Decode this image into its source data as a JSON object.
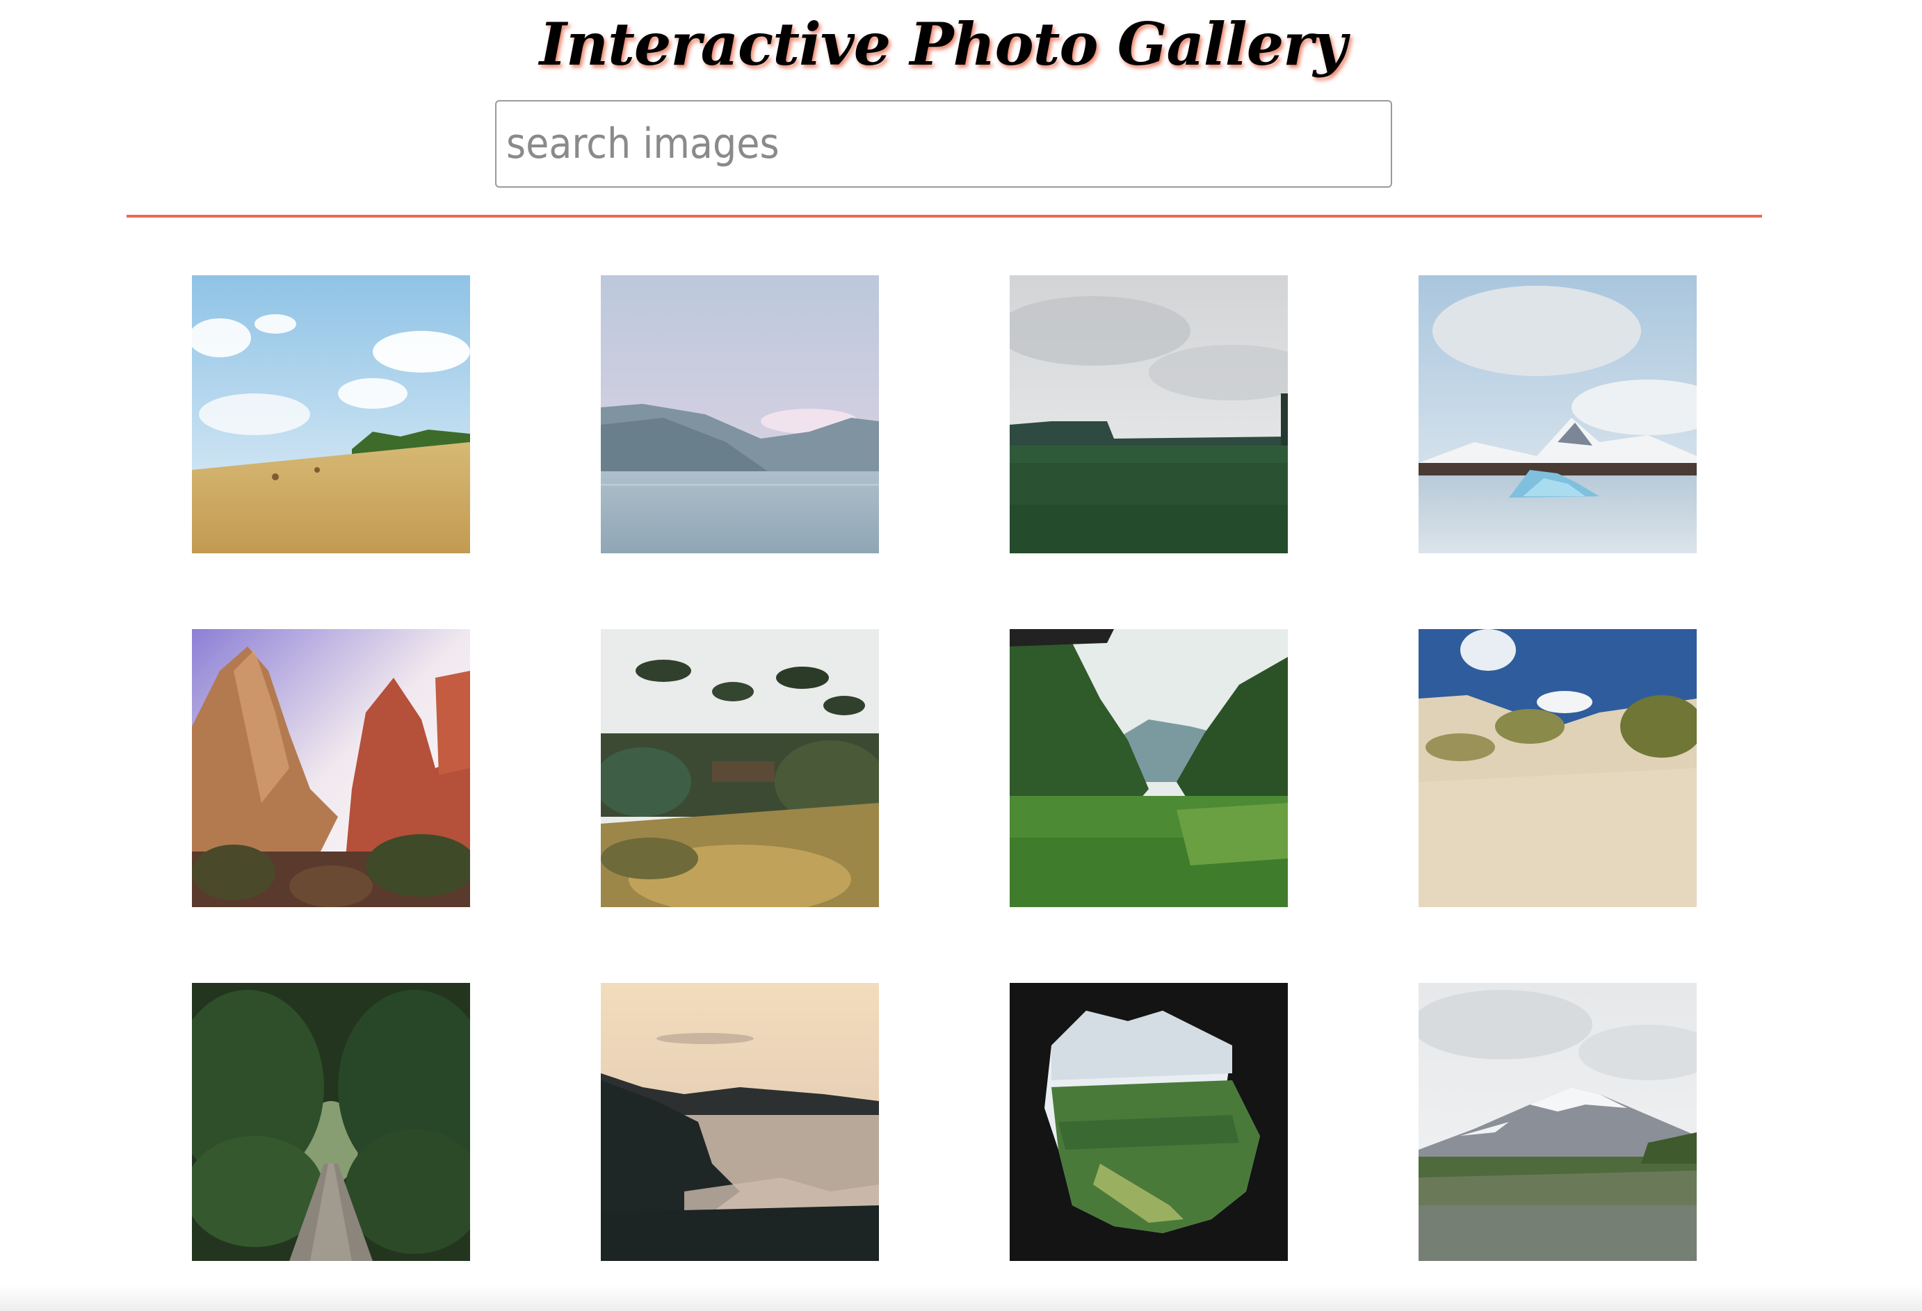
{
  "header": {
    "title": "Interactive Photo Gallery"
  },
  "search": {
    "placeholder": "search images",
    "value": ""
  },
  "colors": {
    "accent": "#e86b4f",
    "title_shadow": "#e96e50"
  },
  "gallery": {
    "columns": 4,
    "rows": 3,
    "images": [
      {
        "subject": "wheat-field-under-cloudy-sky"
      },
      {
        "subject": "misty-lake-with-mountains"
      },
      {
        "subject": "green-meadow-under-overcast-sky"
      },
      {
        "subject": "glacier-lagoon-with-icebergs"
      },
      {
        "subject": "red-rock-canyon-cliffs"
      },
      {
        "subject": "overgrown-garden-with-pines"
      },
      {
        "subject": "green-valley-through-jungle"
      },
      {
        "subject": "sand-dunes-with-grass"
      },
      {
        "subject": "forest-path-tunnel"
      },
      {
        "subject": "coastal-cliffs-at-sunset"
      },
      {
        "subject": "valley-seen-through-cave"
      },
      {
        "subject": "snowy-mountain-over-lupine-field"
      }
    ]
  }
}
